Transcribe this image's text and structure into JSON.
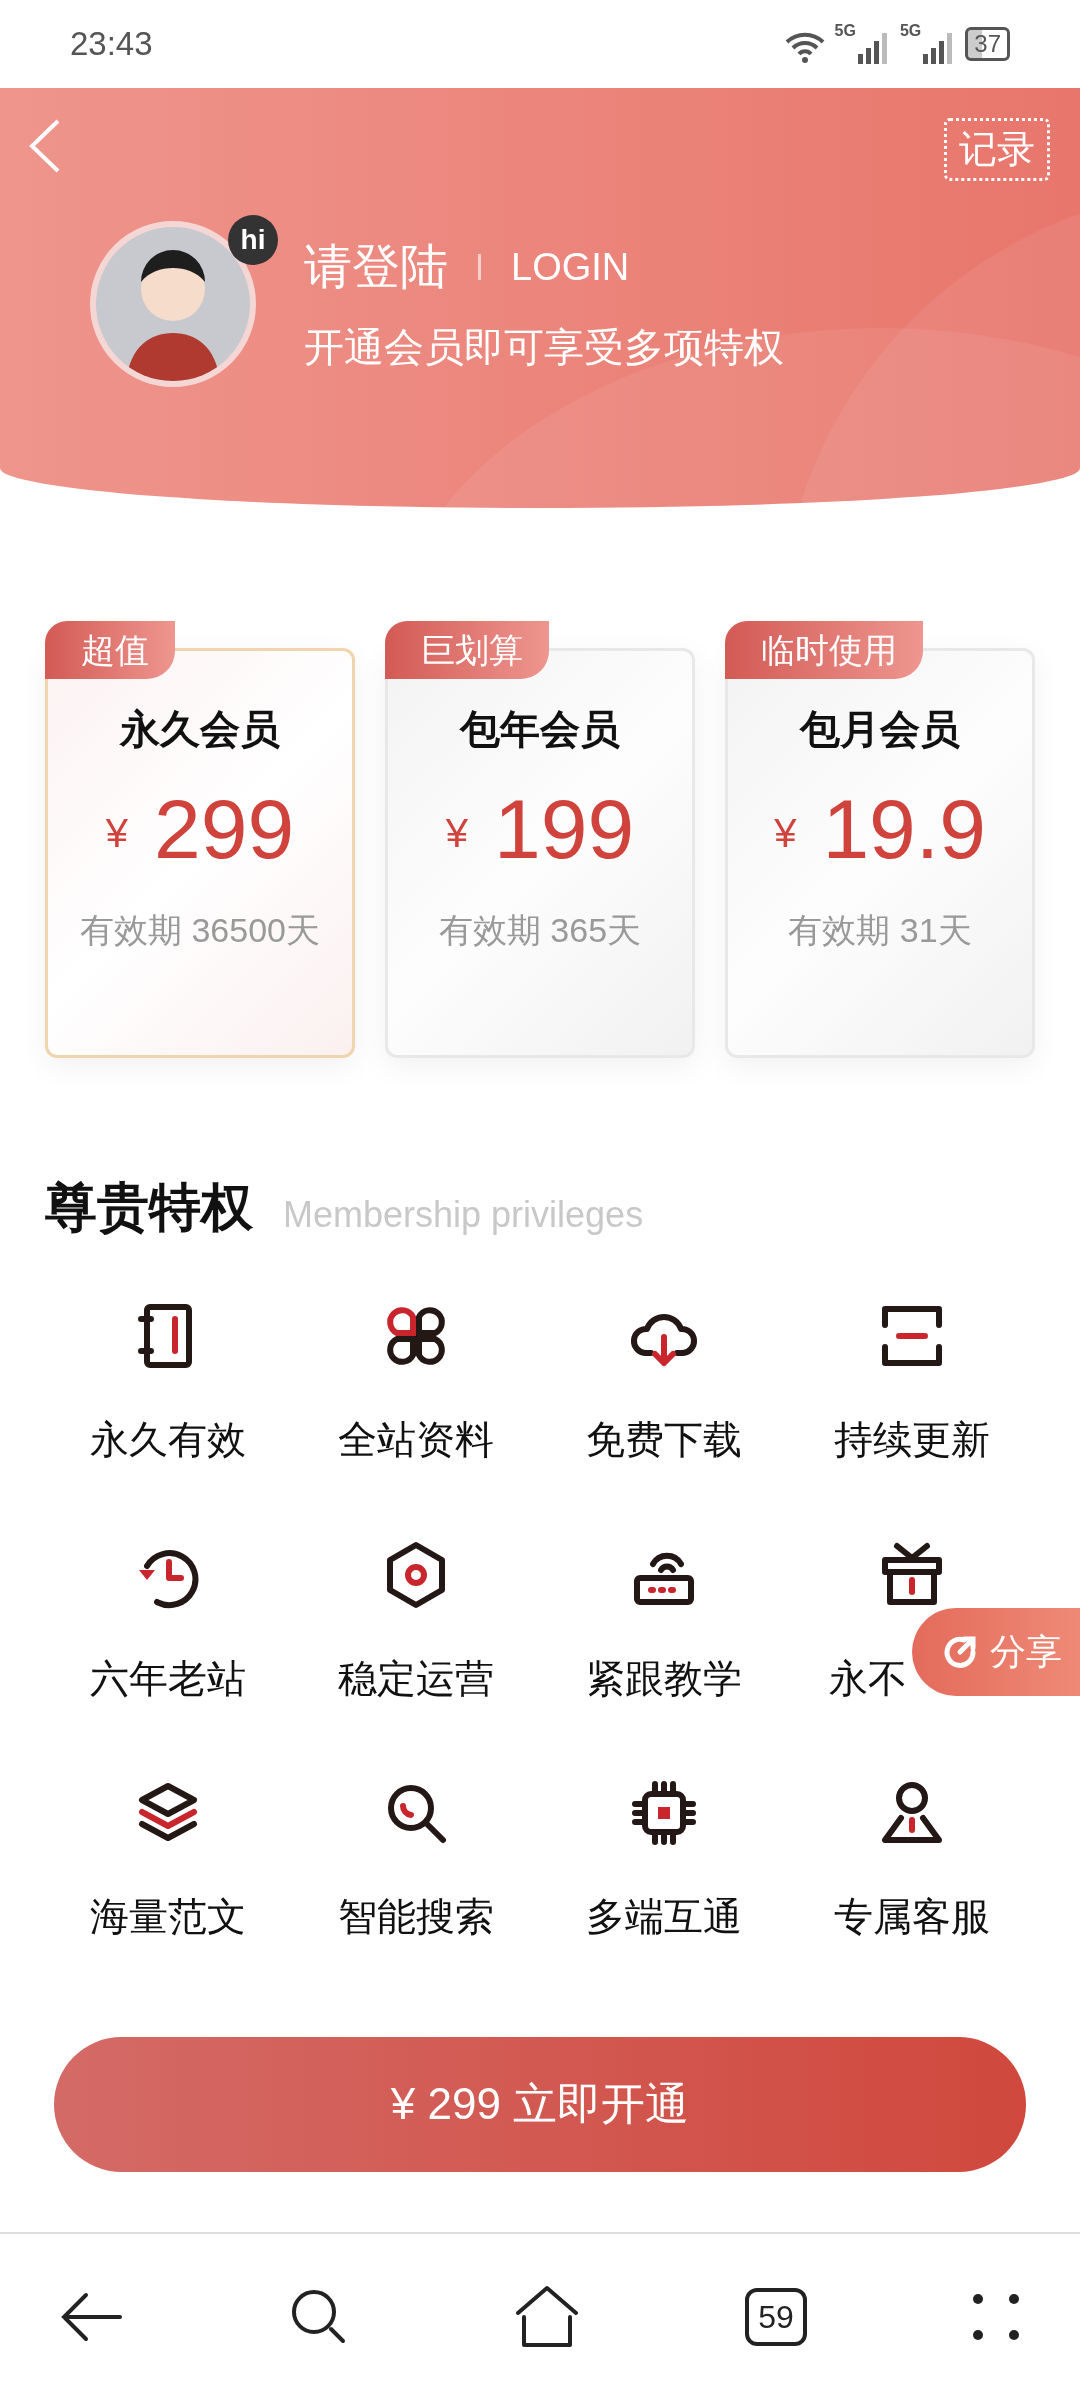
{
  "status_bar": {
    "time": "23:43",
    "network_1": "5G",
    "network_2": "5G",
    "battery": "37"
  },
  "header": {
    "records_button": "记录",
    "avatar_badge": "hi",
    "title": "请登陆",
    "title_en": "LOGIN",
    "subtitle": "开通会员即可享受多项特权"
  },
  "plans": [
    {
      "tag": "超值",
      "name": "永久会员",
      "currency": "¥",
      "price": "299",
      "validity": "有效期 36500天",
      "selected": true
    },
    {
      "tag": "巨划算",
      "name": "包年会员",
      "currency": "¥",
      "price": "199",
      "validity": "有效期 365天",
      "selected": false
    },
    {
      "tag": "临时使用",
      "name": "包月会员",
      "currency": "¥",
      "price": "19.9",
      "validity": "有效期 31天",
      "selected": false
    }
  ],
  "privileges": {
    "title": "尊贵特权",
    "subtitle": "Membership privileges",
    "items": [
      {
        "label": "永久有效"
      },
      {
        "label": "全站资料"
      },
      {
        "label": "免费下载"
      },
      {
        "label": "持续更新"
      },
      {
        "label": "六年老站"
      },
      {
        "label": "稳定运营"
      },
      {
        "label": "紧跟教学"
      },
      {
        "label": "永不"
      },
      {
        "label": "海量范文"
      },
      {
        "label": "智能搜索"
      },
      {
        "label": "多端互通"
      },
      {
        "label": "专属客服"
      }
    ]
  },
  "share_button": "分享",
  "buy_button": "¥ 299 立即开通",
  "browser_nav": {
    "tab_count": "59"
  }
}
